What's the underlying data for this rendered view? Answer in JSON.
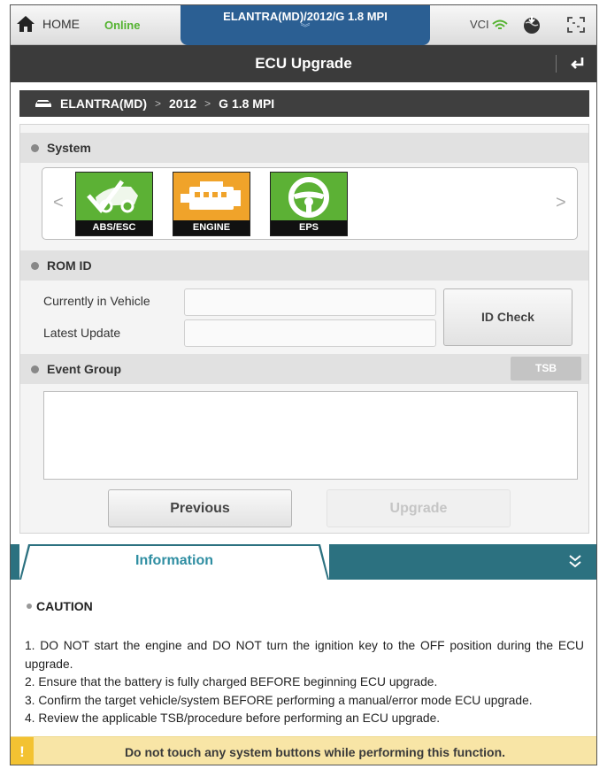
{
  "topbar": {
    "home_label": "HOME",
    "status": "Online",
    "vehicle": "ELANTRA(MD)/2012/G 1.8 MPI",
    "vci_label": "VCI",
    "colors": {
      "online": "#54b330",
      "vehicle_tab": "#2b5f93"
    },
    "icons": [
      "home-icon",
      "chevron-down-icon",
      "wifi-icon",
      "globe-download-icon",
      "fullscreen-icon"
    ]
  },
  "titlebar": {
    "title": "ECU Upgrade",
    "icon": "back-icon"
  },
  "breadcrumb": {
    "icon": "car-icon",
    "items": [
      "ELANTRA(MD)",
      "2012",
      "G 1.8 MPI"
    ],
    "separator": ">"
  },
  "system": {
    "heading": "System",
    "items": [
      {
        "label": "ABS/ESC",
        "icon": "abs-esc-icon",
        "color": "#5cb135"
      },
      {
        "label": "ENGINE",
        "icon": "engine-icon",
        "color": "#f0a32a"
      },
      {
        "label": "EPS",
        "icon": "steering-wheel-icon",
        "color": "#5cb135"
      }
    ],
    "prev_arrow": "<",
    "next_arrow": ">"
  },
  "rom_id": {
    "heading": "ROM ID",
    "current_label": "Currently in Vehicle",
    "current_value": "",
    "latest_label": "Latest Update",
    "latest_value": "",
    "id_check_label": "ID Check"
  },
  "event_group": {
    "heading": "Event Group",
    "tsb_label": "TSB"
  },
  "actions": {
    "previous_label": "Previous",
    "upgrade_label": "Upgrade"
  },
  "information": {
    "tab_label": "Information",
    "caution_title": "CAUTION",
    "lines": [
      "1. DO NOT start the engine and DO NOT turn the ignition key to the OFF position during the ECU upgrade.",
      "2. Ensure that the battery is fully charged BEFORE beginning ECU upgrade.",
      "3. Confirm the target vehicle/system BEFORE performing a manual/error mode ECU upgrade.",
      "4. Review the applicable TSB/procedure before performing an ECU upgrade."
    ]
  },
  "warning": {
    "icon": "!",
    "message": "Do not touch any system buttons while performing this function."
  }
}
